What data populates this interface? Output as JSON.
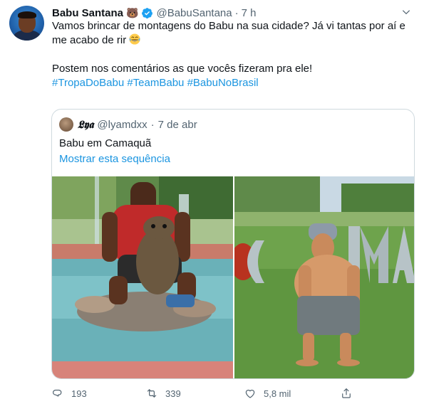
{
  "tweet": {
    "author_name": "Babu Santana",
    "author_emoji": "🐻",
    "handle": "@BabuSantana",
    "separator": "·",
    "time": "7 h",
    "line1": "Vamos brincar de montagens do Babu na sua cidade? Já vi tantas por aí e",
    "line2": "me acabo de rir",
    "line3": "Postem nos comentários as que vocês fizeram pra ele!",
    "hashtags": "#TropaDoBabu #TeamBabu #BabuNoBrasil"
  },
  "quoted": {
    "author_name": "𝕷𝖞𝖆",
    "handle": "@lyamdxx",
    "separator": "·",
    "date": "7 de abr",
    "text": "Babu em Camaquã",
    "link": "Mostrar esta sequência"
  },
  "actions": {
    "replies": "193",
    "retweets": "339",
    "likes": "5,8 mil"
  },
  "icons": {
    "verified": "verified-badge-icon",
    "caret": "chevron-down-icon",
    "reply": "reply-icon",
    "retweet": "retweet-icon",
    "like": "heart-icon",
    "share": "share-icon",
    "emoji": "laughing-tears-emoji"
  },
  "colors": {
    "link": "#1b95e0",
    "verified": "#1da1f2",
    "muted": "#536471",
    "text": "#0f1419",
    "border": "#cfd9de"
  }
}
